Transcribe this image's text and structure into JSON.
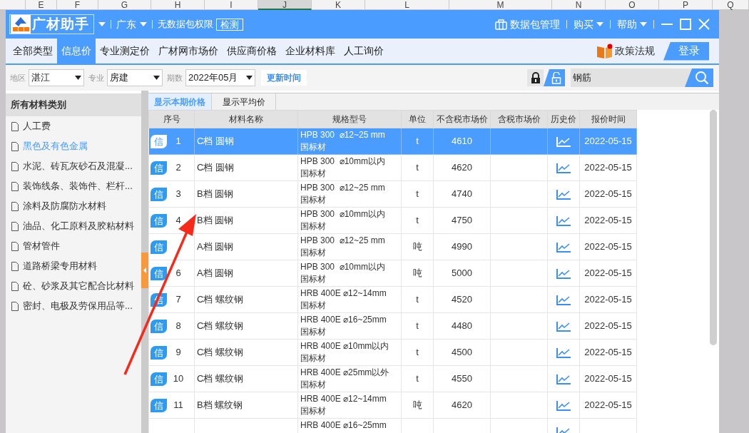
{
  "spreadsheet": {
    "columns": [
      "",
      "E",
      "F",
      "G",
      "H",
      "I",
      "J",
      "K",
      "L",
      "M",
      "N",
      "O",
      "P",
      "Q"
    ]
  },
  "window": {
    "app_name": "广材助手",
    "region": "广东",
    "permission": "无数据包权限",
    "check_button": "检测",
    "package_manager": "数据包管理",
    "menus": [
      "购买",
      "帮助"
    ]
  },
  "tabs": [
    {
      "label": "全部类型",
      "selected": false
    },
    {
      "label": "信息价",
      "selected": true
    },
    {
      "label": "专业测定价",
      "selected": false
    },
    {
      "label": "广材网市场价",
      "selected": false
    },
    {
      "label": "供应商价格",
      "selected": false
    },
    {
      "label": "企业材料库",
      "selected": false
    },
    {
      "label": "人工询价",
      "selected": false
    }
  ],
  "policy_link": "政策法规",
  "login_button": "登录",
  "filters": [
    {
      "label": "地区",
      "value": "湛江"
    },
    {
      "label": "专业",
      "value": "房建"
    },
    {
      "label": "期数",
      "value": "2022年05月"
    }
  ],
  "update_button": "更新时间",
  "search": {
    "value": "钢筋"
  },
  "sidebar": {
    "title": "所有材料类别",
    "items": [
      {
        "label": "人工费",
        "selected": false
      },
      {
        "label": "黑色及有色金属",
        "selected": true
      },
      {
        "label": "水泥、砖瓦灰砂石及混凝...",
        "selected": false
      },
      {
        "label": "装饰线条、装饰件、栏杆...",
        "selected": false
      },
      {
        "label": "涂料及防腐防水材料",
        "selected": false
      },
      {
        "label": "油品、化工原料及胶粘材料",
        "selected": false
      },
      {
        "label": "管材管件",
        "selected": false
      },
      {
        "label": "道路桥梁专用材料",
        "selected": false
      },
      {
        "label": "砼、砂浆及其它配合比材料",
        "selected": false
      },
      {
        "label": "密封、电极及劳保用品等...",
        "selected": false
      }
    ]
  },
  "price_views": [
    {
      "label": "显示本期价格",
      "selected": true
    },
    {
      "label": "显示平均价",
      "selected": false
    }
  ],
  "table": {
    "columns": [
      "序号",
      "材料名称",
      "规格型号",
      "单位",
      "不含税市场价",
      "含税市场价",
      "历史价",
      "报价时间"
    ],
    "rows": [
      {
        "badge": "信",
        "seq": "1",
        "name": "C档 圆钢",
        "spec": "HPB 300  ⌀12~25 mm",
        "spec_note": "国标材",
        "unit": "t",
        "price": "4610",
        "date": "2022-05-15",
        "selected": true
      },
      {
        "badge": "信",
        "seq": "2",
        "name": "C档 圆钢",
        "spec": "HPB 300  ⌀10mm以内",
        "spec_note": "国标材",
        "unit": "t",
        "price": "4620",
        "date": "2022-05-15",
        "selected": false
      },
      {
        "badge": "信",
        "seq": "3",
        "name": "B档 圆钢",
        "spec": "HPB 300  ⌀12~25 mm",
        "spec_note": "国标材",
        "unit": "t",
        "price": "4740",
        "date": "2022-05-15",
        "selected": false
      },
      {
        "badge": "信",
        "seq": "4",
        "name": "B档 圆钢",
        "spec": "HPB 300  ⌀10mm以内",
        "spec_note": "国标材",
        "unit": "t",
        "price": "4750",
        "date": "2022-05-15",
        "selected": false
      },
      {
        "badge": "信",
        "name": "A档 圆钢",
        "spec": "HPB 300  ⌀12~25 mm",
        "spec_note": "国标材",
        "unit": "吨",
        "price": "4990",
        "date": "2022-05-15",
        "selected": false
      },
      {
        "badge": "信",
        "seq": "6",
        "name": "A档 圆钢",
        "spec": "HPB 300  ⌀10mm以内",
        "spec_note": "国标材",
        "unit": "吨",
        "price": "5000",
        "date": "2022-05-15",
        "selected": false
      },
      {
        "badge": "信",
        "seq": "7",
        "name": "C档 螺纹钢",
        "spec": "HRB 400E ⌀12~14mm",
        "spec_note": "国标材",
        "unit": "t",
        "price": "4520",
        "date": "2022-05-15",
        "selected": false
      },
      {
        "badge": "信",
        "seq": "8",
        "name": "C档 螺纹钢",
        "spec": "HRB 400E ⌀16~25mm",
        "spec_note": "国标材",
        "unit": "t",
        "price": "4480",
        "date": "2022-05-15",
        "selected": false
      },
      {
        "badge": "信",
        "seq": "9",
        "name": "C档 螺纹钢",
        "spec": "HRB 400E ⌀10mm以内",
        "spec_note": "国标材",
        "unit": "t",
        "price": "4500",
        "date": "2022-05-15",
        "selected": false
      },
      {
        "badge": "信",
        "seq": "10",
        "name": "C档 螺纹钢",
        "spec": "HRB 400E ⌀25mm以外",
        "spec_note": "国标材",
        "unit": "t",
        "price": "4550",
        "date": "2022-05-15",
        "selected": false
      },
      {
        "badge": "信",
        "seq": "11",
        "name": "B档 螺纹钢",
        "spec": "HRB 400E ⌀12~14mm",
        "spec_note": "国标材",
        "unit": "吨",
        "price": "4620",
        "date": "2022-05-15",
        "selected": false
      },
      {
        "spec": "HRB 400E ⌀16~25mm",
        "selected": false
      }
    ]
  }
}
